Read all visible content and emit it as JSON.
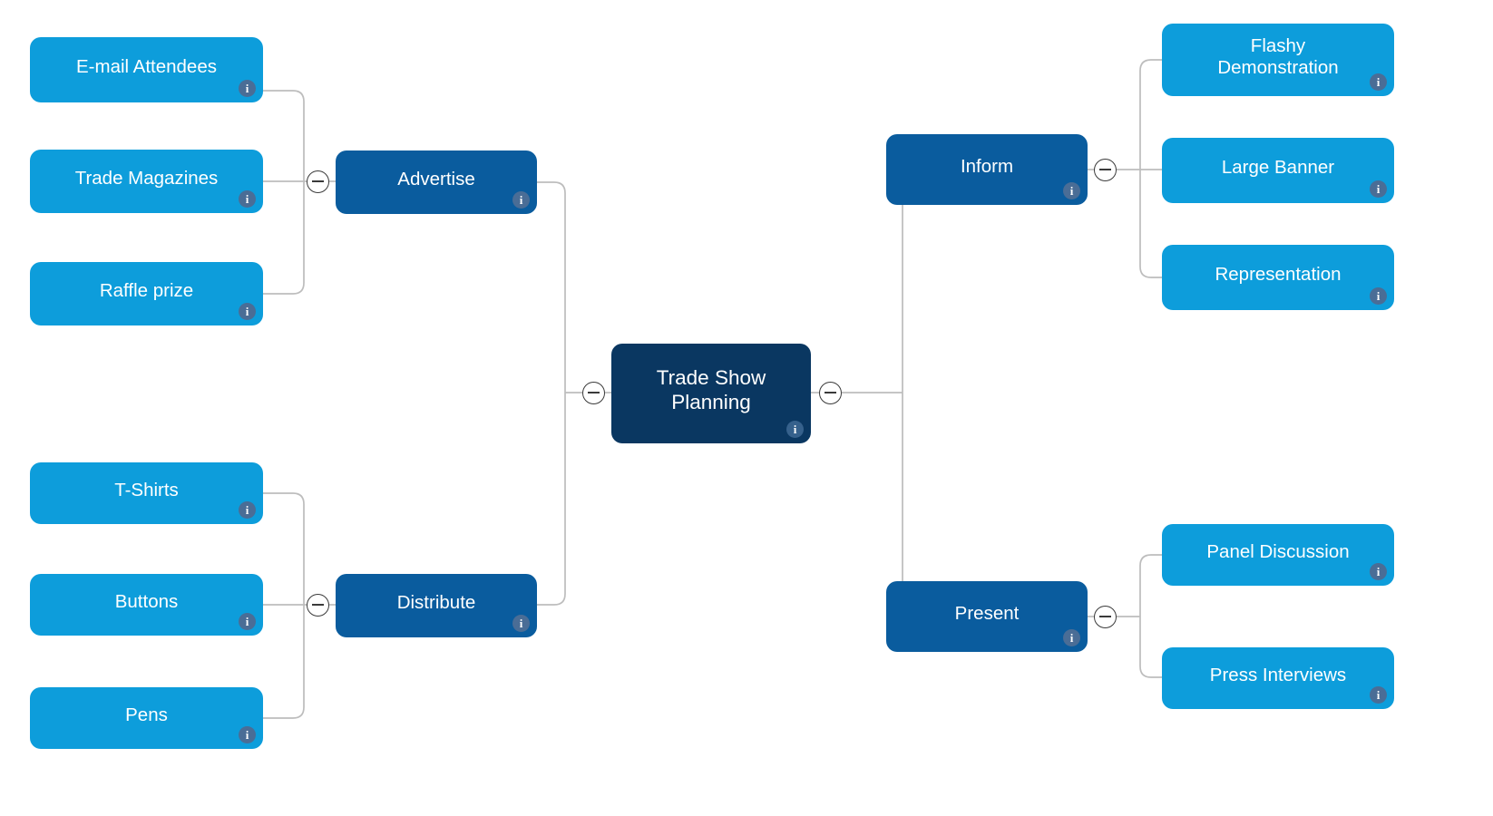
{
  "diagram": {
    "type": "mind-map",
    "title": "Trade Show Planning",
    "background_color": "#ffffff",
    "colors": {
      "root_node": "#0a3761",
      "branch_node": "#0a5c9e",
      "leaf_node": "#0d9ddb",
      "connector_line": "#bdbdbd",
      "info_icon": "#4a6d96",
      "node_text": "#ffffff",
      "collapse_button_border": "#3a3a3a"
    }
  },
  "root": {
    "label": "Trade Show\nPlanning",
    "info_icon": "info-icon"
  },
  "branches": [
    {
      "label": "Advertise",
      "side": "left",
      "info_icon": "info-icon",
      "children": [
        {
          "label": "E-mail Attendees",
          "info_icon": "info-icon"
        },
        {
          "label": "Trade Magazines",
          "info_icon": "info-icon"
        },
        {
          "label": "Raffle prize",
          "info_icon": "info-icon"
        }
      ]
    },
    {
      "label": "Distribute",
      "side": "left",
      "info_icon": "info-icon",
      "children": [
        {
          "label": "T-Shirts",
          "info_icon": "info-icon"
        },
        {
          "label": "Buttons",
          "info_icon": "info-icon"
        },
        {
          "label": "Pens",
          "info_icon": "info-icon"
        }
      ]
    },
    {
      "label": "Inform",
      "side": "right",
      "info_icon": "info-icon",
      "children": [
        {
          "label": "Flashy\nDemonstration",
          "info_icon": "info-icon"
        },
        {
          "label": "Large Banner",
          "info_icon": "info-icon"
        },
        {
          "label": "Representation",
          "info_icon": "info-icon"
        }
      ]
    },
    {
      "label": "Present",
      "side": "right",
      "info_icon": "info-icon",
      "children": [
        {
          "label": "Panel Discussion",
          "info_icon": "info-icon"
        },
        {
          "label": "Press Interviews",
          "info_icon": "info-icon"
        }
      ]
    }
  ],
  "collapse_buttons": [
    {
      "name": "collapse-advertise",
      "glyph": "minus"
    },
    {
      "name": "collapse-distribute",
      "glyph": "minus"
    },
    {
      "name": "collapse-root-left",
      "glyph": "minus"
    },
    {
      "name": "collapse-root-right",
      "glyph": "minus"
    },
    {
      "name": "collapse-inform",
      "glyph": "minus"
    },
    {
      "name": "collapse-present",
      "glyph": "minus"
    }
  ]
}
